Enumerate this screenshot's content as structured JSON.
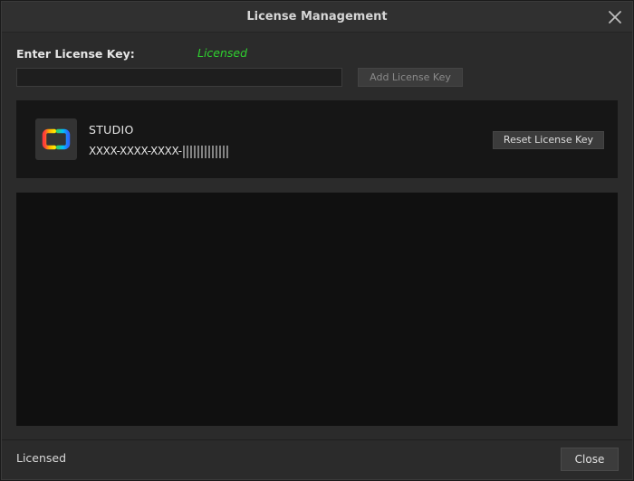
{
  "window": {
    "title": "License Management",
    "close_icon": "close-icon"
  },
  "license_entry": {
    "label": "Enter License Key:",
    "status": "Licensed",
    "status_color": "#2fd12f",
    "input_value": "",
    "input_placeholder": "",
    "add_button_label": "Add License Key"
  },
  "license_item": {
    "product_name": "STUDIO",
    "key_visible": "XXXX-XXXX-XXXX-",
    "icon": "app-logo-icon",
    "reset_button_label": "Reset License Key"
  },
  "footer": {
    "status": "Licensed",
    "close_button_label": "Close"
  }
}
